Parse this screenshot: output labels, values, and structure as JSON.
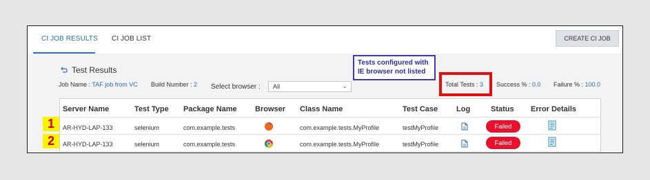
{
  "tabs": [
    {
      "label": "CI JOB RESULTS",
      "active": true
    },
    {
      "label": "CI JOB LIST",
      "active": false
    }
  ],
  "create_button": "CREATE CI JOB",
  "section_title": "Test Results",
  "meta": {
    "job_name_label": "Job Name : ",
    "job_name_value": "TAF job from VC",
    "build_number_label": "Build Number : ",
    "build_number_value": "2",
    "total_tests_label": "Total Tests : ",
    "total_tests_value": "3",
    "success_label": "Success % : ",
    "success_value": "0.0",
    "failure_label": "Failure % : ",
    "failure_value": "100.0"
  },
  "browser_select": {
    "label": "Select browser :",
    "value": "All"
  },
  "callout": {
    "line1": "Tests configured with",
    "line2": "IE browser not listed"
  },
  "table": {
    "headers": [
      "Server Name",
      "Test Type",
      "Package Name",
      "Browser",
      "Class Name",
      "Test Case",
      "Log",
      "Status",
      "Error Details"
    ],
    "rows": [
      {
        "server": "AR-HYD-LAP-133",
        "type": "selenium",
        "package": "com.example.tests",
        "browser_icon": "firefox-icon",
        "class_name": "com.example.tests.MyProfile",
        "test_case": "testMyProfile",
        "status": "Failed"
      },
      {
        "server": "AR-HYD-LAP-133",
        "type": "selenium",
        "package": "com.example.tests",
        "browser_icon": "chrome-icon",
        "class_name": "com.example.tests.MyProfile",
        "test_case": "testMyProfile",
        "status": "Failed"
      }
    ]
  },
  "markers": [
    "1",
    "2"
  ],
  "colors": {
    "accent": "#2f6fb3",
    "failed": "#e8112d",
    "callout_blue": "#3b3bb0",
    "callout_red": "#e01010",
    "marker_bg": "#fff200",
    "marker_text": "#d10000"
  }
}
